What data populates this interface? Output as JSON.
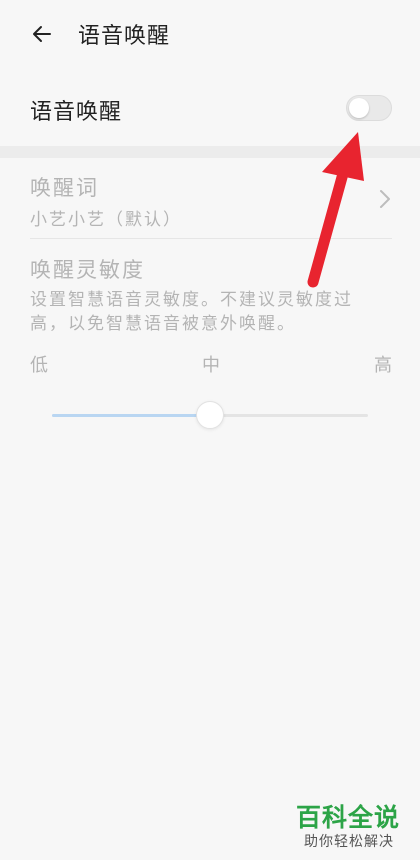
{
  "header": {
    "title": "语音唤醒"
  },
  "voice_wake": {
    "label": "语音唤醒",
    "enabled": false
  },
  "wake_word": {
    "title": "唤醒词",
    "value": "小艺小艺（默认）"
  },
  "sensitivity": {
    "title": "唤醒灵敏度",
    "description": "设置智慧语音灵敏度。不建议灵敏度过高，以免智慧语音被意外唤醒。",
    "low_label": "低",
    "mid_label": "中",
    "high_label": "高",
    "level": 0.5
  },
  "colors": {
    "arrow": "#e8242f",
    "slider_fill": "#b9d6f2",
    "watermark": "#2ca447"
  },
  "watermark": {
    "brand": "百科全说",
    "tagline": "助你轻松解决"
  }
}
